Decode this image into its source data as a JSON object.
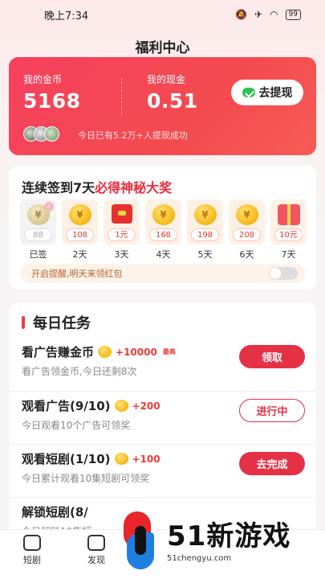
{
  "status_bar": {
    "time": "晚上7:34",
    "battery": "99"
  },
  "page_title": "福利中心",
  "wallet": {
    "coins_label": "我的金币",
    "coins_value": "5168",
    "cash_label": "我的现金",
    "cash_value": "0.51",
    "withdraw_label": "去提现",
    "success_text": "今日已有5.2万+人提现成功"
  },
  "checkin": {
    "title_prefix": "连续签到7天",
    "title_highlight": "必得神秘大奖",
    "days": [
      {
        "amount": "88",
        "label": "已签",
        "reward": "coin",
        "done": true
      },
      {
        "amount": "108",
        "label": "2天",
        "reward": "coin"
      },
      {
        "amount": "1元",
        "label": "3天",
        "reward": "redpack"
      },
      {
        "amount": "168",
        "label": "4天",
        "reward": "coin"
      },
      {
        "amount": "198",
        "label": "5天",
        "reward": "coin"
      },
      {
        "amount": "208",
        "label": "6天",
        "reward": "coin"
      },
      {
        "amount": "10元",
        "label": "7天",
        "reward": "gift"
      }
    ],
    "remind_text": "开启提醒,明天来领红包",
    "remind_on": false
  },
  "tasks": {
    "title": "每日任务",
    "items": [
      {
        "name": "看广告赚金币",
        "reward": "+10000",
        "badge": "最高",
        "desc": "看广告领金币,今日还剩8次",
        "button": "领取",
        "style": "solid"
      },
      {
        "name": "观看广告(9/10)",
        "reward": "+200",
        "desc": "今日观看10个广告可领奖",
        "button": "进行中",
        "style": "outline"
      },
      {
        "name": "观看短剧(1/10)",
        "reward": "+100",
        "desc": "今日累计观看10集短剧可领奖",
        "button": "去完成",
        "style": "solid"
      },
      {
        "name": "解锁短剧(8/",
        "desc": "今日解锁10集短"
      }
    ]
  },
  "tabbar": {
    "tab1": "短剧",
    "tab2": "发现"
  },
  "watermark": {
    "title": "51新游戏",
    "url": "51chengyu.com"
  },
  "colors": {
    "accent": "#e53145",
    "card_gradient_start": "#f6415f",
    "coin": "#f6b613"
  }
}
